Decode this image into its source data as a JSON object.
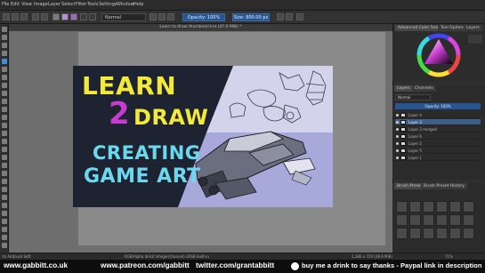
{
  "app": {
    "menu": [
      "File",
      "Edit",
      "View",
      "Image",
      "Layer",
      "Select",
      "Filter",
      "Tools",
      "Settings",
      "Window",
      "Help"
    ],
    "toolbar": {
      "blend_mode": "Normal",
      "opacity_label": "Opacity: 100%",
      "size_label": "Size: 800.00 px"
    },
    "document_tab": "Learn to draw thumbnail.kra (47.0 MiB) *"
  },
  "artwork": {
    "title_line1": "LEARN",
    "title_number": "2",
    "title_line2": "DRAW",
    "subtitle_line1": "CREATING",
    "subtitle_line2": "GAME ART",
    "colors": {
      "dark_bg": "#1d2330",
      "yellow": "#f3e93a",
      "magenta": "#c83bd0",
      "cyan": "#6ad9f0",
      "lavender": "#a6a9d9",
      "sketch_bg": "#d3d4ec"
    }
  },
  "docker": {
    "color_tabs": [
      "Advanced Color Selector",
      "Tool Options",
      "Layers"
    ],
    "layers_tabs": [
      "Layers",
      "Channels"
    ],
    "blend_mode": "Normal",
    "opacity": "Opacity: 100%",
    "layers": [
      {
        "name": "Layer 4",
        "selected": false
      },
      {
        "name": "Layer 3",
        "selected": true
      },
      {
        "name": "Layer 3 merged",
        "selected": false
      },
      {
        "name": "Layer 6",
        "selected": false
      },
      {
        "name": "Layer 2",
        "selected": false
      },
      {
        "name": "Layer 5",
        "selected": false
      },
      {
        "name": "Layer 1",
        "selected": false
      }
    ],
    "brush_tabs": [
      "Brush Presets",
      "Brush Preset History"
    ]
  },
  "status": {
    "left": "b) Airbrush Soft",
    "color_info": "RGB/Alpha (8-bit integer/channel)  sRGB built-in",
    "dimensions": "1,280 x 720 (28.6 MiB)",
    "zoom": "71%"
  },
  "footer": {
    "site": "www.gabbitt.co.uk",
    "patreon": "www.patreon.com/gabbitt",
    "twitter": "twitter.com/grantabbitt",
    "donate": "buy me a drink to say thanks - Paypal link in description"
  }
}
